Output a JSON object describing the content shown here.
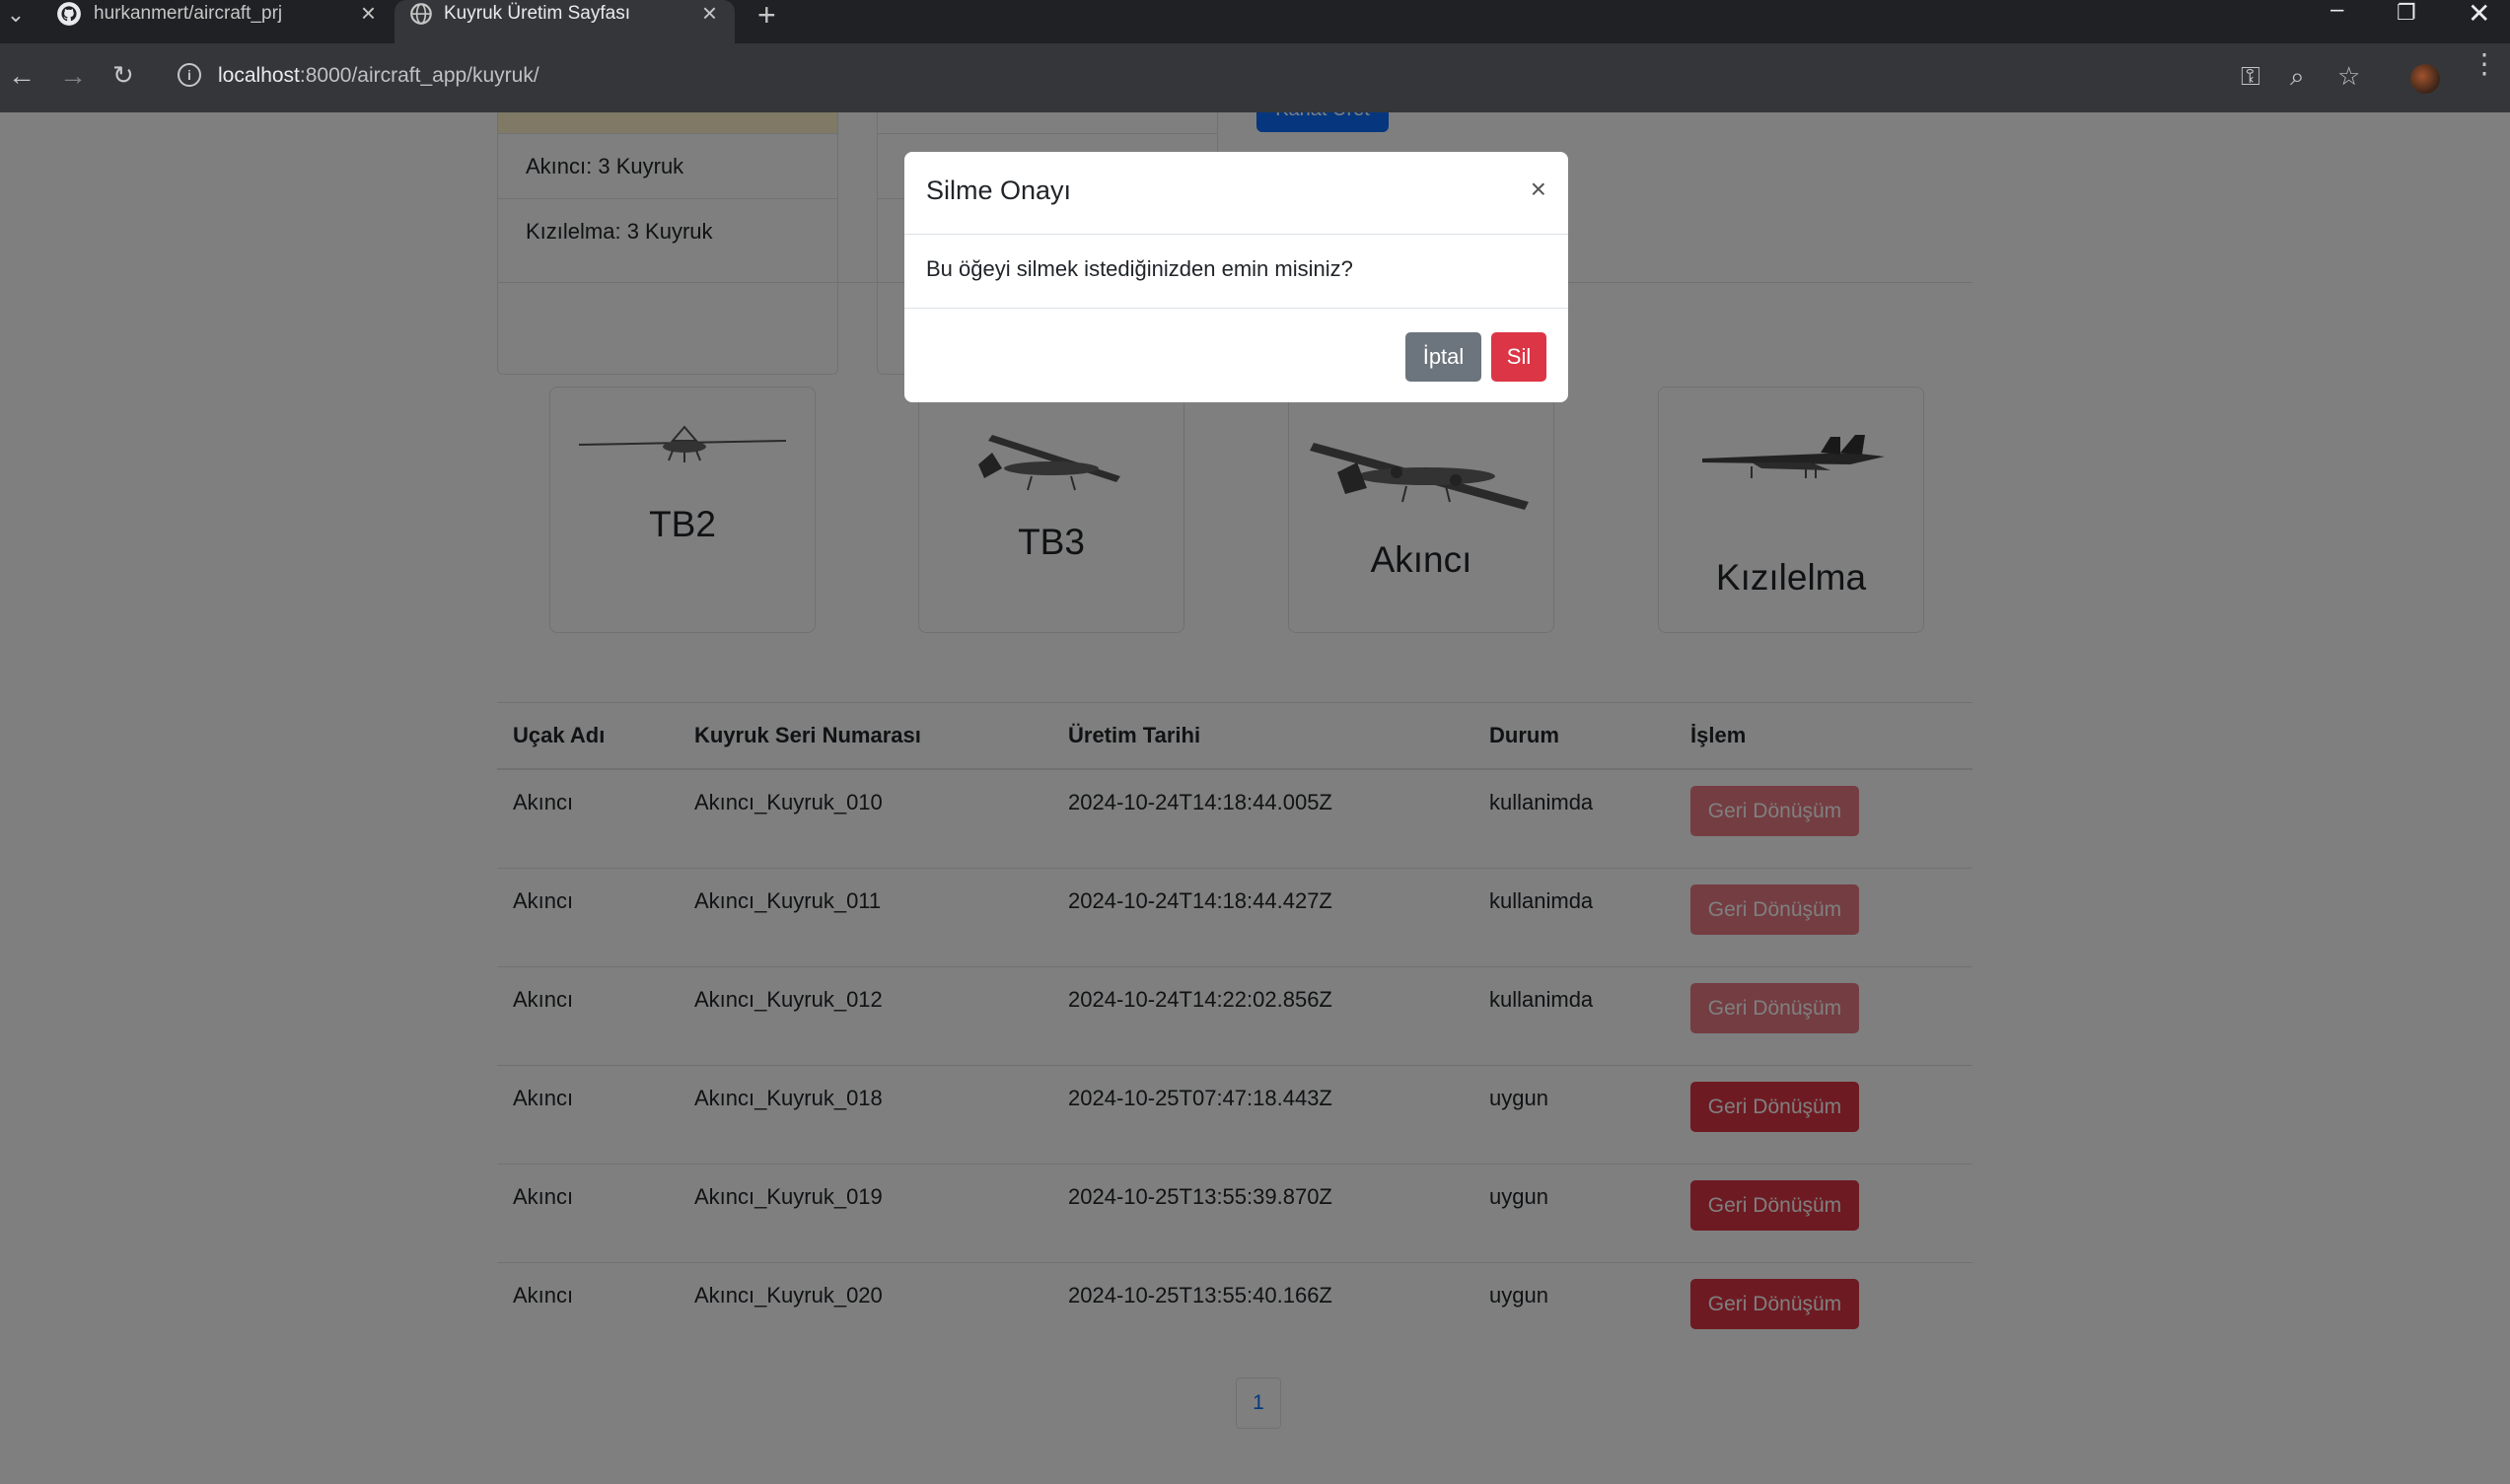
{
  "browser": {
    "tabs": [
      {
        "title": "hurkanmert/aircraft_prj",
        "icon": "github-icon"
      },
      {
        "title": "Kuyruk Üretim Sayfası",
        "icon": "globe-icon"
      }
    ],
    "url_host": "localhost",
    "url_rest": ":8000/aircraft_app/kuyruk/"
  },
  "summary": {
    "items": [
      "Akıncı: 3 Kuyruk",
      "Kızılelma: 3 Kuyruk"
    ]
  },
  "produce_button": "Kanat Üret",
  "aircraft_cards": [
    {
      "name": "TB2"
    },
    {
      "name": "TB3"
    },
    {
      "name": "Akıncı"
    },
    {
      "name": "Kızılelma"
    }
  ],
  "table": {
    "headers": [
      "Uçak Adı",
      "Kuyruk Seri Numarası",
      "Üretim Tarihi",
      "Durum",
      "İşlem"
    ],
    "rows": [
      {
        "plane": "Akıncı",
        "serial": "Akıncı_Kuyruk_010",
        "date": "2024-10-24T14:18:44.005Z",
        "status": "kullanimda",
        "action": "Geri Dönüşüm"
      },
      {
        "plane": "Akıncı",
        "serial": "Akıncı_Kuyruk_011",
        "date": "2024-10-24T14:18:44.427Z",
        "status": "kullanimda",
        "action": "Geri Dönüşüm"
      },
      {
        "plane": "Akıncı",
        "serial": "Akıncı_Kuyruk_012",
        "date": "2024-10-24T14:22:02.856Z",
        "status": "kullanimda",
        "action": "Geri Dönüşüm"
      },
      {
        "plane": "Akıncı",
        "serial": "Akıncı_Kuyruk_018",
        "date": "2024-10-25T07:47:18.443Z",
        "status": "uygun",
        "action": "Geri Dönüşüm"
      },
      {
        "plane": "Akıncı",
        "serial": "Akıncı_Kuyruk_019",
        "date": "2024-10-25T13:55:39.870Z",
        "status": "uygun",
        "action": "Geri Dönüşüm"
      },
      {
        "plane": "Akıncı",
        "serial": "Akıncı_Kuyruk_020",
        "date": "2024-10-25T13:55:40.166Z",
        "status": "uygun",
        "action": "Geri Dönüşüm"
      }
    ]
  },
  "pagination": {
    "current": "1"
  },
  "modal": {
    "title": "Silme Onayı",
    "close": "×",
    "body": "Bu öğeyi silmek istediğinizden emin misiniz?",
    "cancel": "İptal",
    "delete": "Sil"
  },
  "colors": {
    "danger": "#dc3545",
    "secondary": "#6c757d",
    "primary": "#0d6efd",
    "chrome_dark": "#202124",
    "chrome_toolbar": "#35363a"
  }
}
